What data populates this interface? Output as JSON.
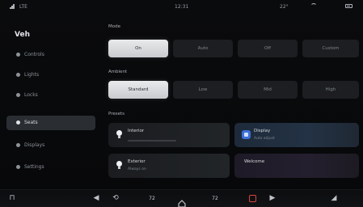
{
  "status_bar": {
    "left_text": "LTE",
    "center_time": "12:31",
    "right_temp": "22°",
    "right_extra": "≡"
  },
  "sidebar": {
    "title": "Veh",
    "items": [
      {
        "label": "Controls"
      },
      {
        "label": "Lights"
      },
      {
        "label": "Locks"
      },
      {
        "label": "Seats"
      },
      {
        "label": "Displays"
      },
      {
        "label": "Settings"
      }
    ],
    "footer": "P"
  },
  "main": {
    "section1_label": "Mode",
    "section1_options": [
      "On",
      "Auto",
      "Off",
      "Custom"
    ],
    "section1_selected": 0,
    "section2_label": "Ambient",
    "section2_options": [
      "Standard",
      "Low",
      "Mid",
      "High"
    ],
    "section2_selected": 0,
    "section3_label": "Presets",
    "cards": [
      {
        "title": "Interior",
        "sub": "Brightness"
      },
      {
        "title": "Display",
        "sub": "Auto adjust"
      },
      {
        "title": "Exterior",
        "sub": "Always on"
      },
      {
        "title": "Welcome",
        "sub": ""
      }
    ]
  },
  "dock": {
    "left_label": "⟲",
    "temp_left": "72",
    "temp_right": "72",
    "items": [
      "◀",
      "▶"
    ]
  },
  "colors": {
    "accent_blue": "#3d6fd8",
    "accent_red": "#e0423c",
    "selected_bg": "#e9eaec"
  }
}
